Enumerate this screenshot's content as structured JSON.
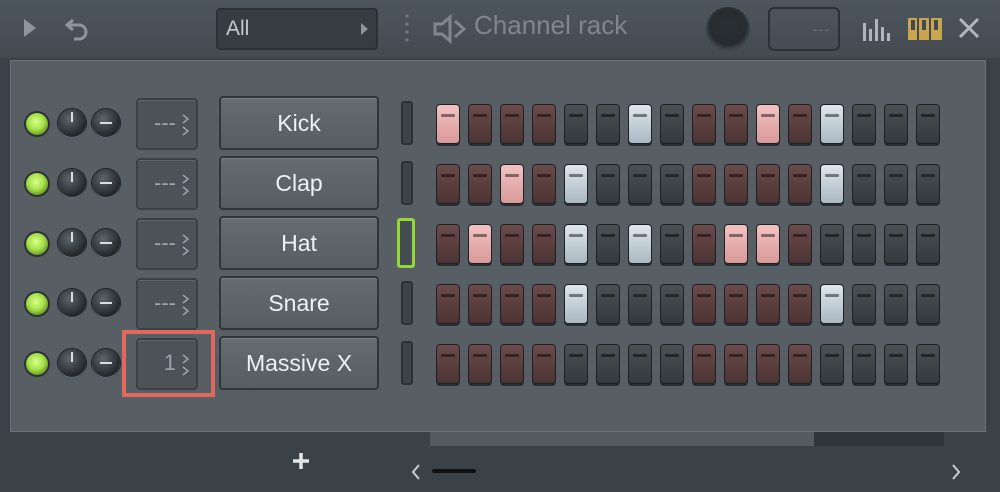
{
  "toolbar": {
    "filter_label": "All",
    "title": "Channel rack",
    "tempo_placeholder": "---"
  },
  "colors": {
    "led_green": "#a5e04a",
    "step_pink": "#f4c2c2",
    "step_light": "#dde6ec",
    "step_dark_red": "#6b4a4a",
    "step_dark": "#33393d",
    "highlight": "#e0685c",
    "selected_outline": "#93d73a"
  },
  "channels": [
    {
      "name": "Kick",
      "route": "---",
      "selected": false,
      "steps": [
        "pink",
        "dark-red",
        "dark-red",
        "dark-red",
        "dark",
        "dark",
        "light",
        "dark",
        "dark-red",
        "dark-red",
        "pink",
        "dark-red",
        "light",
        "dark",
        "dark",
        "dark"
      ]
    },
    {
      "name": "Clap",
      "route": "---",
      "selected": false,
      "steps": [
        "dark-red",
        "dark-red",
        "pink",
        "dark-red",
        "light",
        "dark",
        "dark",
        "dark",
        "dark-red",
        "dark-red",
        "dark-red",
        "dark-red",
        "light",
        "dark",
        "dark",
        "dark"
      ]
    },
    {
      "name": "Hat",
      "route": "---",
      "selected": true,
      "steps": [
        "dark-red",
        "pink",
        "dark-red",
        "dark-red",
        "light",
        "dark",
        "light",
        "dark",
        "dark-red",
        "pink",
        "pink",
        "dark-red",
        "dark",
        "dark",
        "dark",
        "dark"
      ]
    },
    {
      "name": "Snare",
      "route": "---",
      "selected": false,
      "steps": [
        "dark-red",
        "dark-red",
        "dark-red",
        "dark-red",
        "light",
        "dark",
        "dark",
        "dark",
        "dark-red",
        "dark-red",
        "dark-red",
        "dark-red",
        "light",
        "dark",
        "dark",
        "dark"
      ]
    },
    {
      "name": "Massive X",
      "route": "1",
      "selected": false,
      "steps": [
        "dark-red",
        "dark-red",
        "dark-red",
        "dark-red",
        "dark",
        "dark",
        "dark",
        "dark",
        "dark-red",
        "dark-red",
        "dark-red",
        "dark-red",
        "dark",
        "dark",
        "dark",
        "dark"
      ]
    }
  ],
  "footer": {
    "add_icon": "plus-icon",
    "left_icon": "chevron-left-icon",
    "right_icon": "chevron-right-icon"
  }
}
